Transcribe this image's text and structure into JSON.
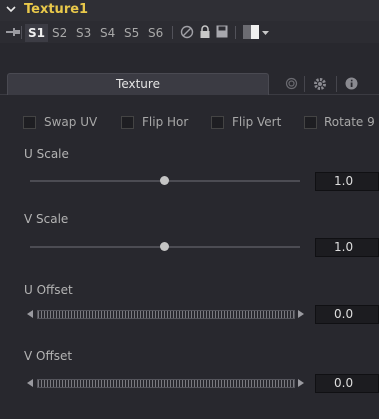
{
  "header": {
    "title": "Texture1",
    "collapse_icon": "chevron-down-icon",
    "accent_color": "#e8c84a"
  },
  "toolbar": {
    "slots": [
      "S1",
      "S2",
      "S3",
      "S4",
      "S5",
      "S6"
    ],
    "active_slot": "S1",
    "icons": [
      "pin-icon",
      "disable-icon",
      "lock-icon",
      "save-icon",
      "color-swatch-icon",
      "dropdown-caret-icon"
    ]
  },
  "tabs": {
    "active_label": "Texture",
    "icons": [
      "spiral-icon",
      "gear-icon",
      "info-icon"
    ]
  },
  "options": [
    {
      "label": "Swap UV",
      "checked": false
    },
    {
      "label": "Flip Hor",
      "checked": false
    },
    {
      "label": "Flip Vert",
      "checked": false
    },
    {
      "label": "Rotate 9",
      "checked": false
    }
  ],
  "controls": {
    "u_scale": {
      "label": "U Scale",
      "value": "1.0",
      "level": 0.5
    },
    "v_scale": {
      "label": "V Scale",
      "value": "1.0",
      "level": 0.5
    },
    "u_offset": {
      "label": "U Offset",
      "value": "0.0"
    },
    "v_offset": {
      "label": "V Offset",
      "value": "0.0"
    }
  }
}
